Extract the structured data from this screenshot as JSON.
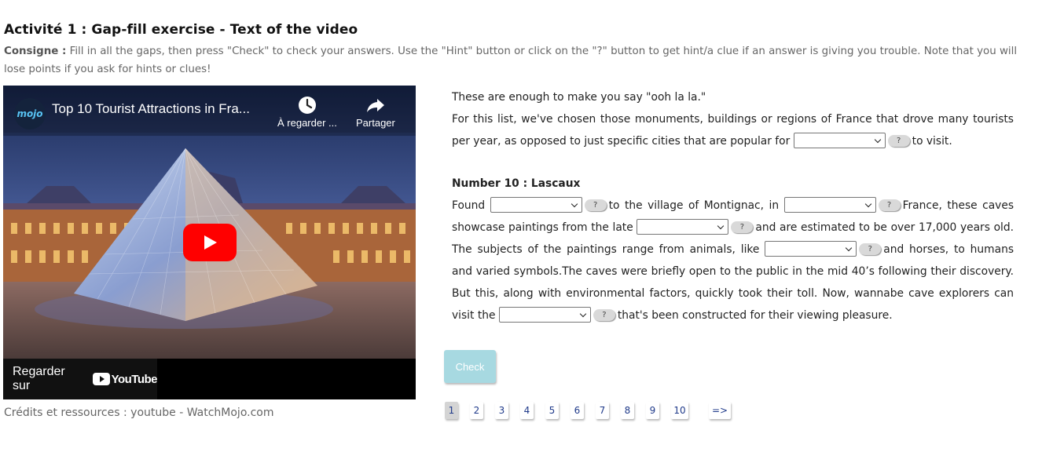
{
  "header": {
    "title": "Activité 1 : Gap-fill exercise - Text of the video",
    "consigne_label": "Consigne :",
    "consigne_text": " Fill in all the gaps, then press \"Check\" to check your answers. Use the \"Hint\" button or click on the \"?\" button to get hint/a clue if an answer is giving you trouble. Note that you will lose points if you ask for hints or clues!"
  },
  "video": {
    "channel_logo": "mojo",
    "title": "Top 10 Tourist Attractions in Fra...",
    "watch_later_label": "À regarder ...",
    "share_label": "Partager",
    "watch_on": "Regarder sur",
    "youtube_label": "YouTube",
    "icons": {
      "watch_later": "clock-icon",
      "share": "share-icon",
      "play": "play-icon"
    }
  },
  "credits": "Crédits et ressources : youtube - WatchMojo.com",
  "exercise": {
    "line1": "These are enough to make you say \"ooh la la.\"",
    "para2_before": "For this list, we've chosen those monuments, buildings or regions of France that drove many tourists per year, as opposed to just specific cities that are popular for",
    "para2_after": "to visit.",
    "heading": "Number 10 : Lascaux",
    "p3_a": "Found",
    "p3_b": "to the village of Montignac, in",
    "p3_c": "France, these caves showcase paintings from the late",
    "p3_d": "and are estimated to be over 17,000 years old. The subjects of the paintings range from animals, like",
    "p3_e": "and horses, to humans and varied symbols.The caves were briefly open to the public in the mid 40’s following their discovery. But this, along with environmental factors, quickly took their toll. Now, wannabe cave explorers can visit the",
    "p3_f": "that's been constructed for their viewing pleasure.",
    "hint_label": "?",
    "check_label": "Check"
  },
  "pagination": {
    "pages": [
      "1",
      "2",
      "3",
      "4",
      "5",
      "6",
      "7",
      "8",
      "9",
      "10"
    ],
    "next_label": "=>",
    "current": "1"
  }
}
